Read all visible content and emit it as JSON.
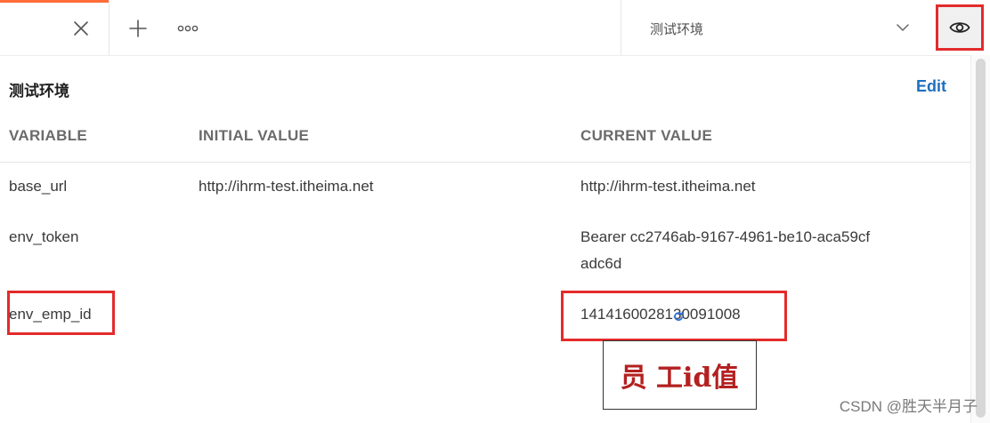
{
  "tabs": {
    "active_tab_label": "",
    "new_tab_icon": "plus-icon",
    "more_icon": "ellipsis-icon",
    "close_icon": "close-icon"
  },
  "environment_selector": {
    "selected": "测试环境",
    "chevron_icon": "chevron-down-icon",
    "quick_look_icon": "eye-icon"
  },
  "panel": {
    "title": "测试环境",
    "edit_label": "Edit",
    "columns": [
      "VARIABLE",
      "INITIAL VALUE",
      "CURRENT VALUE"
    ],
    "rows": [
      {
        "variable": "base_url",
        "initial_value": "http://ihrm-test.itheima.net",
        "current_value": "http://ihrm-test.itheima.net"
      },
      {
        "variable": "env_token",
        "initial_value": "",
        "current_value": "Bearer cc2746ab-9167-4961-be10-aca59cfadc6d"
      },
      {
        "variable": "env_emp_id",
        "initial_value": "",
        "current_value": "1414160028130091008"
      }
    ]
  },
  "annotation": {
    "text": "员 工id值"
  },
  "watermark": "CSDN @胜天半月子",
  "colors": {
    "accent_tab": "#ff6c37",
    "highlight_red": "#e32b2b",
    "edit_link": "#1f6fbf",
    "annotation_text": "#b42020"
  }
}
